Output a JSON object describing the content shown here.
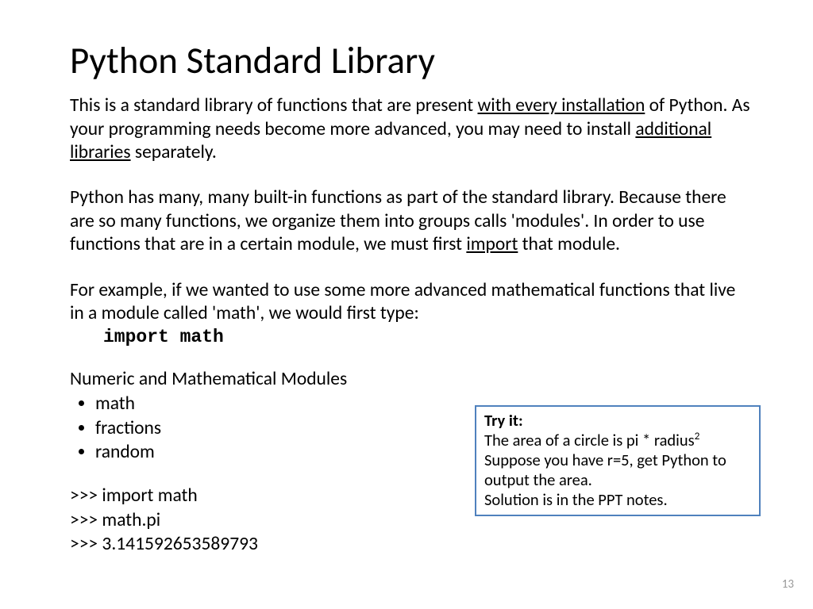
{
  "title": "Python Standard Library",
  "para1": {
    "t1": "This is a standard library of functions that are present ",
    "u1": "with every installation",
    "t2": " of Python. As your programming needs become more advanced, you may need to install ",
    "u2": "additional libraries",
    "t3": " separately."
  },
  "para2": {
    "t1": "Python has many, many built-in functions as part of the standard library. Because there are so many functions, we organize them into groups calls 'modules'.  In order to use functions that are in a certain module, we must first ",
    "u1": "import",
    "t2": " that module."
  },
  "para3": "For example, if we wanted to use some more advanced mathematical functions that live in a module called 'math', we would first type:",
  "code": "import math",
  "modules_header": "Numeric and Mathematical Modules",
  "modules": {
    "m1": "math",
    "m2": "fractions",
    "m3": "random"
  },
  "repl": {
    "l1": ">>> import math",
    "l2": ">>> math.pi",
    "l3": ">>> 3.141592653589793"
  },
  "callout": {
    "heading": "Try it:",
    "l1a": "The area of a circle is pi * radius",
    "l1sup": "2",
    "l2": "Suppose you have r=5, get Python to output the area.",
    "l3": "Solution is in the PPT notes."
  },
  "page_number": "13",
  "colors": {
    "callout_border": "#4F81BD",
    "page_num": "#999999"
  }
}
